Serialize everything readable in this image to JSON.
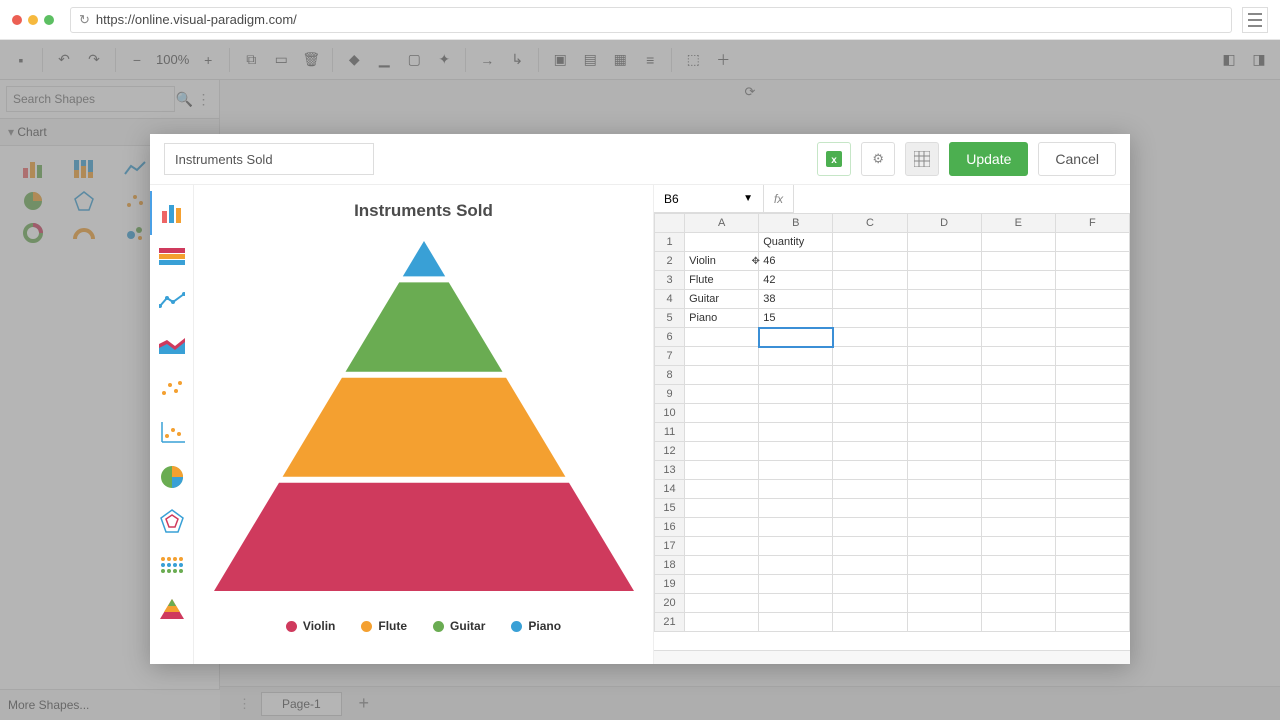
{
  "browser": {
    "url": "https://online.visual-paradigm.com/"
  },
  "toolbar": {
    "zoom": "100%"
  },
  "sidebar": {
    "search_placeholder": "Search Shapes",
    "section": "Chart",
    "more": "More Shapes..."
  },
  "tabs": {
    "page1": "Page-1"
  },
  "modal": {
    "title": "Instruments Sold",
    "update": "Update",
    "cancel": "Cancel"
  },
  "chart_data": {
    "type": "pyramid",
    "title": "Instruments Sold",
    "series_label": "Quantity",
    "categories": [
      "Violin",
      "Flute",
      "Guitar",
      "Piano"
    ],
    "values": [
      46,
      42,
      38,
      15
    ],
    "colors": [
      "#cf3a5d",
      "#f4a030",
      "#6aac52",
      "#39a0d6"
    ]
  },
  "sheet": {
    "active_cell": "B6",
    "columns": [
      "A",
      "B",
      "C",
      "D",
      "E",
      "F"
    ],
    "rows": 21,
    "header_row": {
      "b": "Quantity"
    },
    "data_rows": [
      {
        "a": "Violin",
        "b": "46"
      },
      {
        "a": "Flute",
        "b": "42"
      },
      {
        "a": "Guitar",
        "b": "38"
      },
      {
        "a": "Piano",
        "b": "15"
      }
    ]
  }
}
